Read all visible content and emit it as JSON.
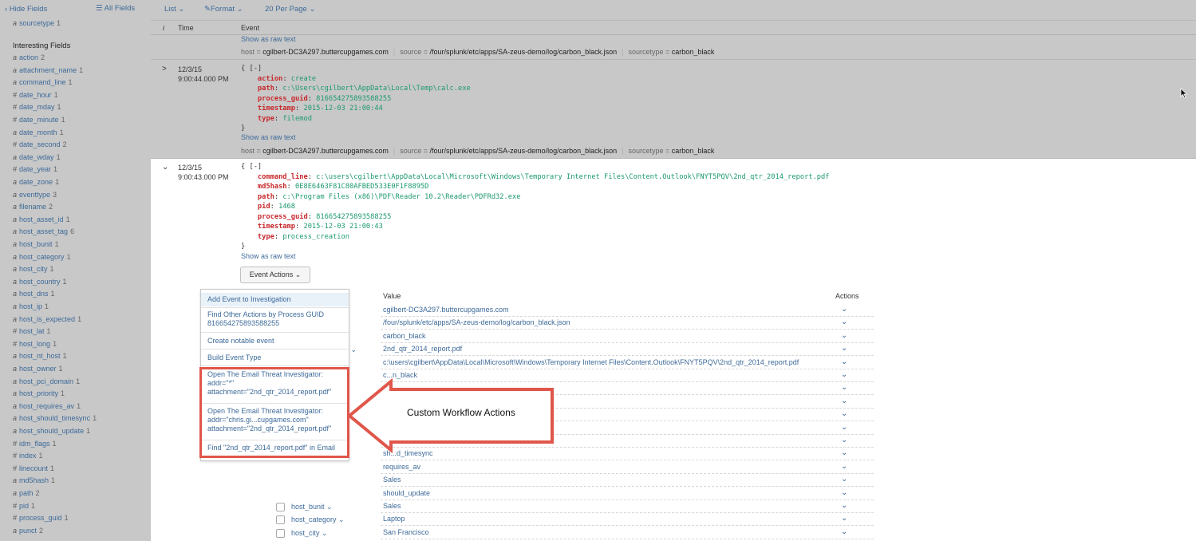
{
  "sidebar": {
    "hide_fields": "‹ Hide Fields",
    "all_fields": "☰ All Fields",
    "top_field": {
      "type": "a",
      "name": "sourcetype",
      "count": "1"
    },
    "interesting_heading": "Interesting Fields",
    "fields": [
      {
        "type": "a",
        "name": "action",
        "count": "2"
      },
      {
        "type": "a",
        "name": "attachment_name",
        "count": "1"
      },
      {
        "type": "a",
        "name": "command_line",
        "count": "1"
      },
      {
        "type": "#",
        "name": "date_hour",
        "count": "1"
      },
      {
        "type": "#",
        "name": "date_mday",
        "count": "1"
      },
      {
        "type": "#",
        "name": "date_minute",
        "count": "1"
      },
      {
        "type": "a",
        "name": "date_month",
        "count": "1"
      },
      {
        "type": "#",
        "name": "date_second",
        "count": "2"
      },
      {
        "type": "a",
        "name": "date_wday",
        "count": "1"
      },
      {
        "type": "#",
        "name": "date_year",
        "count": "1"
      },
      {
        "type": "a",
        "name": "date_zone",
        "count": "1"
      },
      {
        "type": "a",
        "name": "eventtype",
        "count": "3"
      },
      {
        "type": "a",
        "name": "filename",
        "count": "2"
      },
      {
        "type": "a",
        "name": "host_asset_id",
        "count": "1"
      },
      {
        "type": "a",
        "name": "host_asset_tag",
        "count": "6"
      },
      {
        "type": "a",
        "name": "host_bunit",
        "count": "1"
      },
      {
        "type": "a",
        "name": "host_category",
        "count": "1"
      },
      {
        "type": "a",
        "name": "host_city",
        "count": "1"
      },
      {
        "type": "a",
        "name": "host_country",
        "count": "1"
      },
      {
        "type": "a",
        "name": "host_dns",
        "count": "1"
      },
      {
        "type": "a",
        "name": "host_ip",
        "count": "1"
      },
      {
        "type": "a",
        "name": "host_is_expected",
        "count": "1"
      },
      {
        "type": "#",
        "name": "host_lat",
        "count": "1"
      },
      {
        "type": "#",
        "name": "host_long",
        "count": "1"
      },
      {
        "type": "a",
        "name": "host_nt_host",
        "count": "1"
      },
      {
        "type": "a",
        "name": "host_owner",
        "count": "1"
      },
      {
        "type": "a",
        "name": "host_pci_domain",
        "count": "1"
      },
      {
        "type": "a",
        "name": "host_priority",
        "count": "1"
      },
      {
        "type": "a",
        "name": "host_requires_av",
        "count": "1"
      },
      {
        "type": "a",
        "name": "host_should_timesync",
        "count": "1"
      },
      {
        "type": "a",
        "name": "host_should_update",
        "count": "1"
      },
      {
        "type": "#",
        "name": "idm_flags",
        "count": "1"
      },
      {
        "type": "#",
        "name": "index",
        "count": "1"
      },
      {
        "type": "#",
        "name": "linecount",
        "count": "1"
      },
      {
        "type": "a",
        "name": "md5hash",
        "count": "1"
      },
      {
        "type": "a",
        "name": "path",
        "count": "2"
      },
      {
        "type": "#",
        "name": "pid",
        "count": "1"
      },
      {
        "type": "#",
        "name": "process_guid",
        "count": "1"
      },
      {
        "type": "a",
        "name": "punct",
        "count": "2"
      }
    ]
  },
  "toolbar": {
    "list": "List ⌄",
    "format": "✎Format ⌄",
    "per_page": "20 Per Page ⌄"
  },
  "columns": {
    "info": "i",
    "time": "Time",
    "event": "Event"
  },
  "event0": {
    "raw_link": "Show as raw text",
    "host_label": "host =",
    "host": "cgilbert-DC3A297.buttercupgames.com",
    "source_label": "source =",
    "source": "/four/splunk/etc/apps/SA-zeus-demo/log/carbon_black.json",
    "sourcetype_label": "sourcetype =",
    "sourcetype": "carbon_black"
  },
  "event1": {
    "arrow": ">",
    "date": "12/3/15",
    "time": "9:00:44.000 PM",
    "open": "{ [-]",
    "lines": [
      {
        "k": "action",
        "v": "create"
      },
      {
        "k": "path",
        "v": "c:\\Users\\cgilbert\\AppData\\Local\\Temp\\calc.exe"
      },
      {
        "k": "process_guid",
        "v": "816654275893588255"
      },
      {
        "k": "timestamp",
        "v": "2015-12-03 21:00:44"
      },
      {
        "k": "type",
        "v": "filemod"
      }
    ],
    "close": "}",
    "raw_link": "Show as raw text",
    "host_label": "host =",
    "host": "cgilbert-DC3A297.buttercupgames.com",
    "source_label": "source =",
    "source": "/four/splunk/etc/apps/SA-zeus-demo/log/carbon_black.json",
    "sourcetype_label": "sourcetype =",
    "sourcetype": "carbon_black"
  },
  "event2": {
    "arrow": "⌄",
    "date": "12/3/15",
    "time": "9:00:43.000 PM",
    "open": "{ [-]",
    "lines": [
      {
        "k": "command_line",
        "v": "c:\\users\\cgilbert\\AppData\\Local\\Microsoft\\Windows\\Temporary Internet Files\\Content.Outlook\\FNYT5PQV\\2nd_qtr_2014_report.pdf"
      },
      {
        "k": "md5hash",
        "v": "0E8E6463F81C80AFBED533E0F1F8895D"
      },
      {
        "k": "path",
        "v": "c:\\Program Files (x86)\\PDF\\Reader 10.2\\Reader\\PDFRd32.exe"
      },
      {
        "k": "pid",
        "v": "1468"
      },
      {
        "k": "process_guid",
        "v": "816654275893588255"
      },
      {
        "k": "timestamp",
        "v": "2015-12-03 21:00:43"
      },
      {
        "k": "type",
        "v": "process_creation"
      }
    ],
    "close": "}",
    "raw_link": "Show as raw text",
    "event_actions": "Event Actions ⌄"
  },
  "dropdown": {
    "items": [
      "Add Event to Investigation",
      "Find Other Actions by Process GUID 816654275893588255",
      "Create notable event",
      "Build Event Type",
      "Open The Email Threat Investigator: addr=\"*\" attachment=\"2nd_qtr_2014_report.pdf\"",
      "Open The Email Threat Investigator: addr=\"chris.gi...cupgames.com\" attachment=\"2nd_qtr_2014_report.pdf\"",
      "Find \"2nd_qtr_2014_report.pdf\" in Email"
    ]
  },
  "callout": {
    "text": "Custom Workflow Actions"
  },
  "fields_table": {
    "value_header": "Value",
    "actions_header": "Actions",
    "partial_label": "e ⌄",
    "rows": [
      "cgilbert-DC3A297.buttercupgames.com",
      "/four/splunk/etc/apps/SA-zeus-demo/log/carbon_black.json",
      "carbon_black",
      "2nd_qtr_2014_report.pdf",
      "c:\\users\\cgilbert\\AppData\\Local\\Microsoft\\Windows\\Temporary Internet Files\\Content.Outlook\\FNYT5PQV\\2nd_qtr_2014_report.pdf",
      "c...n_black",
      "",
      "",
      "",
      "",
      "...ted",
      "sh...d_timesync",
      "requires_av",
      "Sales",
      "should_update",
      "Sales",
      "Laptop",
      "San Francisco"
    ],
    "labeled_rows": [
      {
        "name": "host_bunit ⌄"
      },
      {
        "name": "host_category ⌄"
      },
      {
        "name": "host_city ⌄"
      }
    ],
    "action_glyph": "⌄"
  }
}
